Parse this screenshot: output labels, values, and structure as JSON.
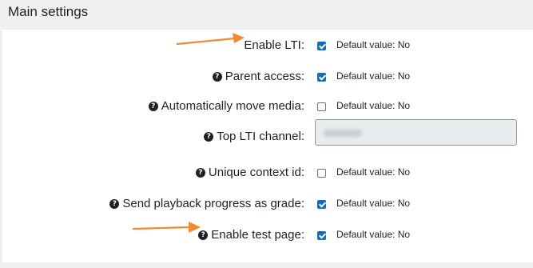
{
  "section": {
    "title": "Main settings"
  },
  "settings": [
    {
      "label": "Enable LTI:",
      "help": false,
      "checked": true,
      "default": "Default value: No"
    },
    {
      "label": "Parent access:",
      "help": true,
      "checked": true,
      "default": "Default value: No"
    },
    {
      "label": "Automatically move media:",
      "help": true,
      "checked": false,
      "default": "Default value: No"
    },
    {
      "label": "Top LTI channel:",
      "help": true
    },
    {
      "label": "Unique context id:",
      "help": true,
      "checked": false,
      "default": "Default value: No"
    },
    {
      "label": "Send playback progress as grade:",
      "help": true,
      "checked": true,
      "default": "Default value: No"
    },
    {
      "label": "Enable test page:",
      "help": true,
      "checked": true,
      "default": "Default value: No"
    }
  ],
  "icons": {
    "help": "question-circle-icon",
    "annotation": "orange-arrow-icon"
  },
  "colors": {
    "checkbox_checked": "#0f6cbf",
    "annotation_arrow": "#f28a2e",
    "disabled_input": "#e9ecef"
  }
}
